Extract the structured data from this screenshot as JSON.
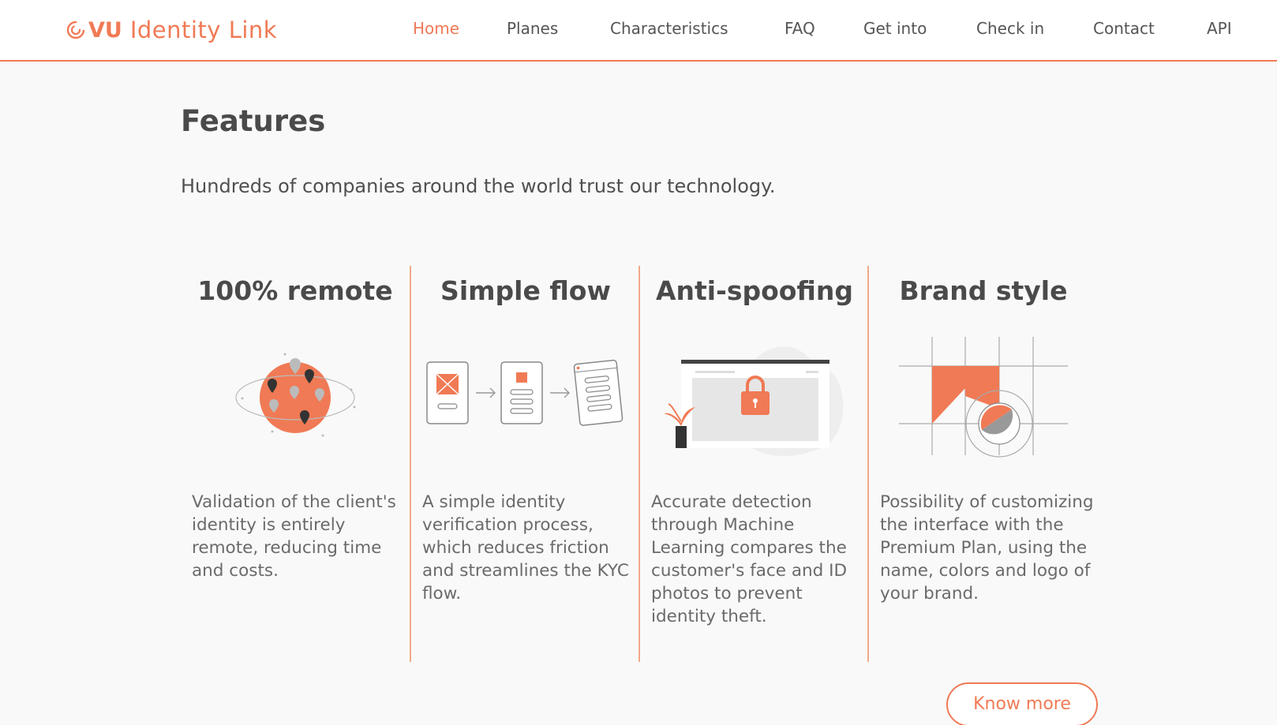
{
  "brand": {
    "vu": "VU",
    "rest": "Identity Link",
    "accent": "#f07a55"
  },
  "nav": {
    "items": [
      {
        "label": "Home",
        "active": true
      },
      {
        "label": "Planes"
      },
      {
        "label": "Characteristics"
      },
      {
        "label": "FAQ"
      },
      {
        "label": "Get into"
      },
      {
        "label": "Check in"
      },
      {
        "label": "Contact"
      },
      {
        "label": "API"
      }
    ]
  },
  "features": {
    "title": "Features",
    "subtitle": "Hundreds of companies around the world trust our technology.",
    "cards": [
      {
        "title": "100% remote",
        "icon": "globe-pins-icon",
        "text": "Validation of the client's identity is entirely remote, reducing time and costs."
      },
      {
        "title": "Simple flow",
        "icon": "document-flow-icon",
        "text": "A simple identity verification process, which reduces friction and streamlines the KYC flow."
      },
      {
        "title": "Anti-spoofing",
        "icon": "browser-lock-icon",
        "text": "Accurate detection through Machine Learning compares the customer's face and ID photos to prevent identity theft."
      },
      {
        "title": "Brand style",
        "icon": "brand-shapes-icon",
        "text": "Possibility of customizing the interface with the Premium Plan, using the name, colors and logo of your brand."
      }
    ],
    "cta": "Know more"
  }
}
